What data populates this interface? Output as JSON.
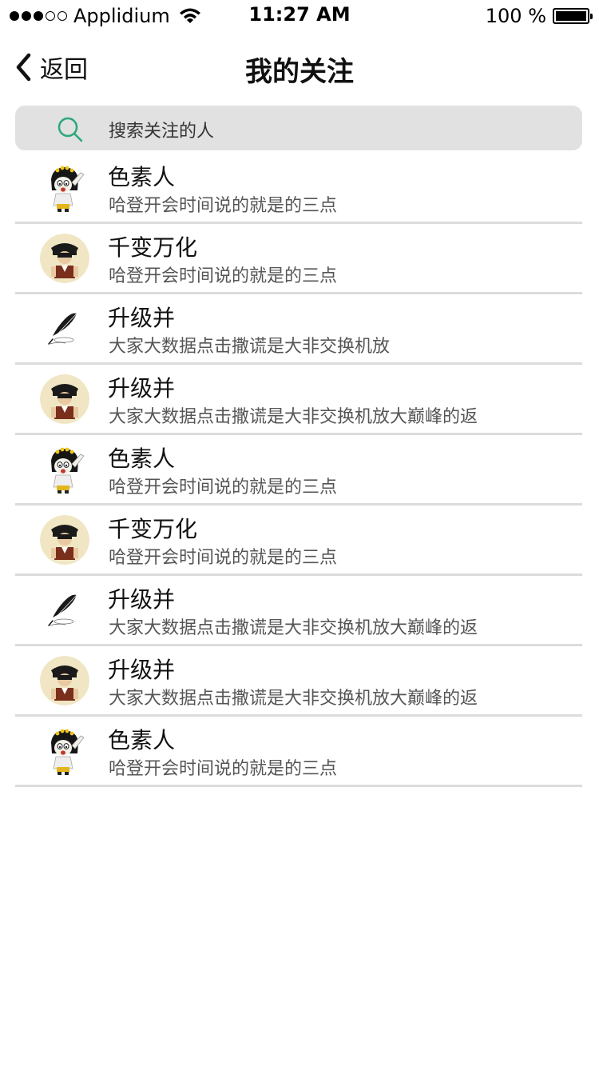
{
  "status_bar": {
    "carrier": "Applidium",
    "time": "11:27 AM",
    "battery": "100 %",
    "signal_bars_filled": 3,
    "signal_bars_total": 5
  },
  "nav": {
    "back_label": "返回",
    "title": "我的关注"
  },
  "search": {
    "placeholder": "搜索关注的人",
    "icon": "search-icon",
    "icon_color": "#2aa878"
  },
  "list": {
    "items": [
      {
        "name": "色素人",
        "desc": "哈登开会时间说的就是的三点",
        "avatar": "girl-avatar"
      },
      {
        "name": "千变万化",
        "desc": "哈登开会时间说的就是的三点",
        "avatar": "boy-avatar"
      },
      {
        "name": "升级并",
        "desc": "大家大数据点击撒谎是大非交换机放",
        "avatar": "quill-avatar"
      },
      {
        "name": "升级并",
        "desc": "大家大数据点击撒谎是大非交换机放大巅峰的返",
        "avatar": "boy-avatar"
      },
      {
        "name": "色素人",
        "desc": "哈登开会时间说的就是的三点",
        "avatar": "girl-avatar"
      },
      {
        "name": "千变万化",
        "desc": "哈登开会时间说的就是的三点",
        "avatar": "boy-avatar"
      },
      {
        "name": "升级并",
        "desc": "大家大数据点击撒谎是大非交换机放大巅峰的返",
        "avatar": "quill-avatar"
      },
      {
        "name": "升级并",
        "desc": "大家大数据点击撒谎是大非交换机放大巅峰的返",
        "avatar": "boy-avatar"
      },
      {
        "name": "色素人",
        "desc": "哈登开会时间说的就是的三点",
        "avatar": "girl-avatar"
      }
    ]
  }
}
